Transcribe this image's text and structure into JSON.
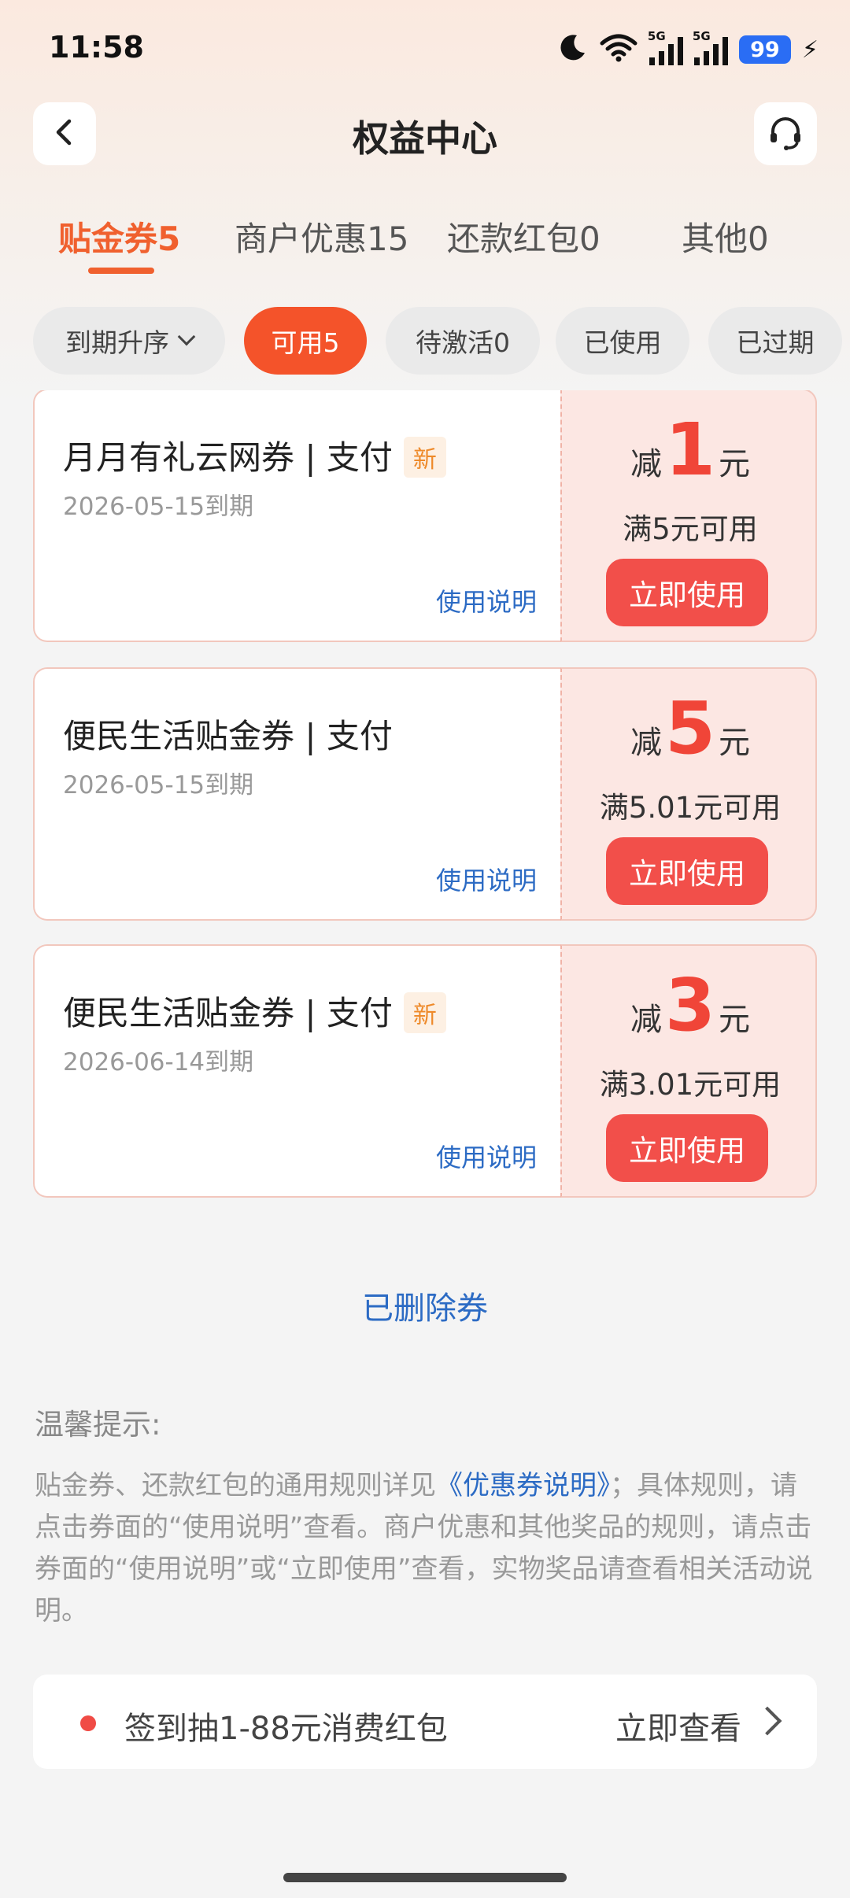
{
  "status_bar": {
    "time": "11:58",
    "signal_label_1": "5G",
    "signal_label_2": "5G",
    "battery": "99",
    "icons": [
      "moon-icon",
      "wifi-icon",
      "signal-icon",
      "signal-icon",
      "battery-icon",
      "charging-icon"
    ]
  },
  "header": {
    "title": "权益中心",
    "back_icon": "chevron-left-icon",
    "support_icon": "headset-icon"
  },
  "tabs": [
    {
      "label": "贴金券5",
      "active": true
    },
    {
      "label": "商户优惠15",
      "active": false
    },
    {
      "label": "还款红包0",
      "active": false
    },
    {
      "label": "其他0",
      "active": false
    }
  ],
  "filters": [
    {
      "label": "到期升序",
      "active": false
    },
    {
      "label": "可用5",
      "active": true
    },
    {
      "label": "待激活0",
      "active": false
    },
    {
      "label": "已使用",
      "active": false
    },
    {
      "label": "已过期",
      "active": false
    }
  ],
  "coupons": [
    {
      "title": "月月有礼云网券 | 支付",
      "badge": "新",
      "expiry": "2026-05-15到期",
      "rules_link": "使用说明",
      "prefix": "减",
      "amount": "1",
      "suffix": "元",
      "threshold": "满5元可用",
      "action": "立即使用"
    },
    {
      "title": "便民生活贴金券 | 支付",
      "badge": "",
      "expiry": "2026-05-15到期",
      "rules_link": "使用说明",
      "prefix": "减",
      "amount": "5",
      "suffix": "元",
      "threshold": "满5.01元可用",
      "action": "立即使用"
    },
    {
      "title": "便民生活贴金券 | 支付",
      "badge": "新",
      "expiry": "2026-06-14到期",
      "rules_link": "使用说明",
      "prefix": "减",
      "amount": "3",
      "suffix": "元",
      "threshold": "满3.01元可用",
      "action": "立即使用"
    }
  ],
  "deleted_link": "已删除券",
  "tips": {
    "title": "温馨提示:",
    "text_before": "贴金券、还款红包的通用规则详见",
    "link": "《优惠券说明》",
    "text_after": "；具体规则，请点击券面的“使用说明”查看。商户优惠和其他奖品的规则，请点击券面的“使用说明”或“立即使用”查看，实物奖品请查看相关活动说明。"
  },
  "promo": {
    "text": "签到抽1-88元消费红包",
    "cta": "立即查看"
  },
  "colors": {
    "accent": "#f0602e",
    "coupon_red": "#f24f4a",
    "link_blue": "#2c6bc4",
    "coupon_bg": "#fce7e3"
  }
}
